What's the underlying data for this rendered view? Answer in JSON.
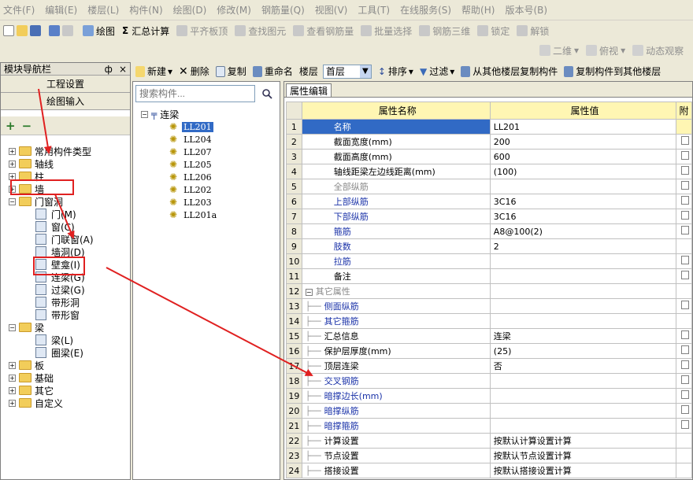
{
  "menu": [
    "文件(F)",
    "编辑(E)",
    "楼层(L)",
    "构件(N)",
    "绘图(D)",
    "修改(M)",
    "钢筋量(Q)",
    "视图(V)",
    "工具(T)",
    "在线服务(S)",
    "帮助(H)",
    "版本号(B)"
  ],
  "toolbar": {
    "draw": "绘图",
    "sigma": "Σ",
    "summary": "汇总计算",
    "align_slab": "平齐板顶",
    "find": "查找图元",
    "view_rebar": "查看钢筋量",
    "batch": "批量选择",
    "rebar3d": "钢筋三维",
    "lock": "锁定",
    "unlock": "解锁"
  },
  "toolbar2": {
    "view2d": "二维",
    "top_view": "俯视",
    "dynamic": "动态观察"
  },
  "nav": {
    "title": "模块导航栏",
    "pin": "ф",
    "close": "×",
    "project_settings": "工程设置",
    "draw_input": "绘图输入",
    "plus": "+",
    "minus": "−",
    "tree": [
      {
        "label": "常用构件类型",
        "level": 0,
        "exp": "+"
      },
      {
        "label": "轴线",
        "level": 0,
        "exp": "+"
      },
      {
        "label": "柱",
        "level": 0,
        "exp": "+"
      },
      {
        "label": "墙",
        "level": 0,
        "exp": "+"
      },
      {
        "label": "门窗洞",
        "level": 0,
        "exp": "−"
      },
      {
        "label": "门(M)",
        "level": 1
      },
      {
        "label": "窗(C)",
        "level": 1
      },
      {
        "label": "门联窗(A)",
        "level": 1
      },
      {
        "label": "墙洞(D)",
        "level": 1
      },
      {
        "label": "壁龛(I)",
        "level": 1
      },
      {
        "label": "连梁(G)",
        "level": 1
      },
      {
        "label": "过梁(G)",
        "level": 1
      },
      {
        "label": "带形洞",
        "level": 1
      },
      {
        "label": "带形窗",
        "level": 1
      },
      {
        "label": "梁",
        "level": 0,
        "exp": "−"
      },
      {
        "label": "梁(L)",
        "level": 1
      },
      {
        "label": "圈梁(E)",
        "level": 1
      },
      {
        "label": "板",
        "level": 0,
        "exp": "+"
      },
      {
        "label": "基础",
        "level": 0,
        "exp": "+"
      },
      {
        "label": "其它",
        "level": 0,
        "exp": "+"
      },
      {
        "label": "自定义",
        "level": 0,
        "exp": "+"
      }
    ]
  },
  "actions": {
    "new": "新建",
    "delete": "删除",
    "copy": "复制",
    "rename": "重命名",
    "floor_label": "楼层",
    "floor_value": "首层",
    "sort": "排序",
    "filter": "过滤",
    "copy_from": "从其他楼层复制构件",
    "copy_to": "复制构件到其他楼层"
  },
  "list": {
    "search_placeholder": "搜索构件...",
    "root": "连梁",
    "items": [
      "LL201",
      "LL204",
      "LL207",
      "LL205",
      "LL206",
      "LL202",
      "LL203",
      "LL201a"
    ]
  },
  "props": {
    "tab": "属性编辑",
    "col_name": "属性名称",
    "col_value": "属性值",
    "col_extra": "附",
    "rows": [
      {
        "n": "1",
        "name": "名称",
        "value": "LL201",
        "style": "blue",
        "check": false
      },
      {
        "n": "2",
        "name": "截面宽度(mm)",
        "value": "200",
        "style": "",
        "check": true
      },
      {
        "n": "3",
        "name": "截面高度(mm)",
        "value": "600",
        "style": "",
        "check": true
      },
      {
        "n": "4",
        "name": "轴线距梁左边线距离(mm)",
        "value": "(100)",
        "style": "",
        "check": true
      },
      {
        "n": "5",
        "name": "全部纵筋",
        "value": "",
        "style": "gray",
        "check": true
      },
      {
        "n": "6",
        "name": "上部纵筋",
        "value": "3C16",
        "style": "blue",
        "check": true
      },
      {
        "n": "7",
        "name": "下部纵筋",
        "value": "3C16",
        "style": "blue",
        "check": true
      },
      {
        "n": "8",
        "name": "箍筋",
        "value": "A8@100(2)",
        "style": "blue",
        "check": true
      },
      {
        "n": "9",
        "name": "肢数",
        "value": "2",
        "style": "blue",
        "check": false
      },
      {
        "n": "10",
        "name": "拉筋",
        "value": "",
        "style": "blue",
        "check": true
      },
      {
        "n": "11",
        "name": "备注",
        "value": "",
        "style": "",
        "check": true
      },
      {
        "n": "12",
        "name": "其它属性",
        "value": "",
        "style": "gray",
        "check": false,
        "group": true
      },
      {
        "n": "13",
        "name": "侧面纵筋",
        "value": "",
        "style": "blue",
        "check": true,
        "indent": true
      },
      {
        "n": "14",
        "name": "其它箍筋",
        "value": "",
        "style": "blue",
        "check": false,
        "indent": true
      },
      {
        "n": "15",
        "name": "汇总信息",
        "value": "连梁",
        "style": "",
        "check": true,
        "indent": true
      },
      {
        "n": "16",
        "name": "保护层厚度(mm)",
        "value": "(25)",
        "style": "",
        "check": true,
        "indent": true
      },
      {
        "n": "17",
        "name": "顶层连梁",
        "value": "否",
        "style": "",
        "check": true,
        "indent": true
      },
      {
        "n": "18",
        "name": "交叉钢筋",
        "value": "",
        "style": "blue",
        "check": true,
        "indent": true
      },
      {
        "n": "19",
        "name": "暗撑边长(mm)",
        "value": "",
        "style": "blue",
        "check": true,
        "indent": true
      },
      {
        "n": "20",
        "name": "暗撑纵筋",
        "value": "",
        "style": "blue",
        "check": true,
        "indent": true
      },
      {
        "n": "21",
        "name": "暗撑箍筋",
        "value": "",
        "style": "blue",
        "check": true,
        "indent": true
      },
      {
        "n": "22",
        "name": "计算设置",
        "value": "按默认计算设置计算",
        "style": "",
        "check": false,
        "indent": true
      },
      {
        "n": "23",
        "name": "节点设置",
        "value": "按默认节点设置计算",
        "style": "",
        "check": false,
        "indent": true
      },
      {
        "n": "24",
        "name": "搭接设置",
        "value": "按默认搭接设置计算",
        "style": "",
        "check": false,
        "indent": true
      }
    ]
  },
  "colors": {
    "annotation_red": "#e02020",
    "header_yellow": "#fff6b3",
    "selected_blue": "#316ac5"
  }
}
